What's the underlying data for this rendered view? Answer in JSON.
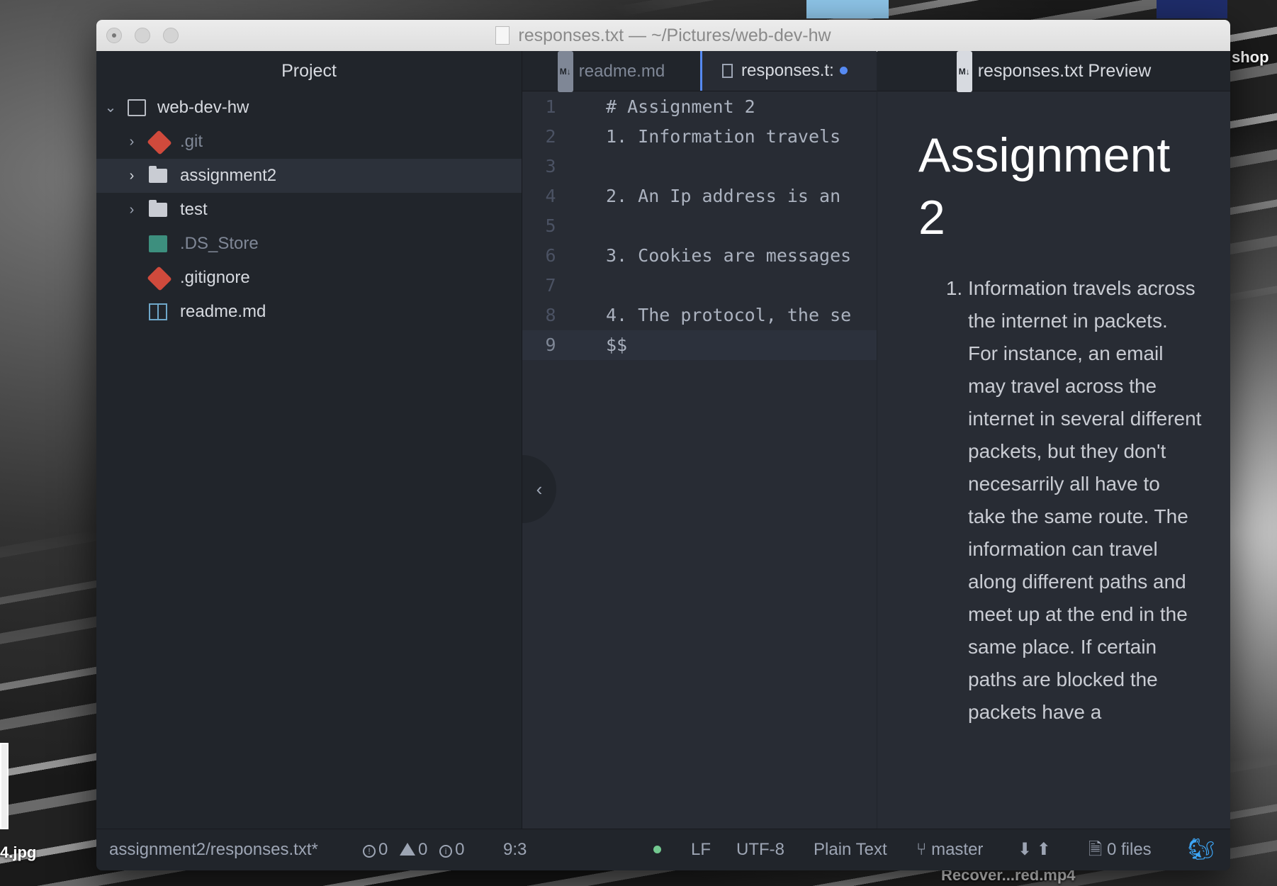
{
  "desktop": {
    "labels": [
      "shop",
      "4.jpg",
      "Recover...red.mp4"
    ]
  },
  "window": {
    "title": "responses.txt — ~/Pictures/web-dev-hw"
  },
  "sidebar": {
    "header": "Project",
    "root": "web-dev-hw",
    "items": [
      {
        "label": ".git",
        "icon": "git-icon"
      },
      {
        "label": "assignment2",
        "icon": "folder-icon"
      },
      {
        "label": "test",
        "icon": "folder-icon"
      },
      {
        "label": ".DS_Store",
        "icon": "finder-icon"
      },
      {
        "label": ".gitignore",
        "icon": "git-icon"
      },
      {
        "label": "readme.md",
        "icon": "book-icon"
      }
    ]
  },
  "tabs": [
    {
      "label": "readme.md",
      "badge": "M↓"
    },
    {
      "label": "responses.t:",
      "modified": true
    }
  ],
  "editor": {
    "lines": [
      {
        "num": "1",
        "text": "# Assignment 2"
      },
      {
        "num": "2",
        "text": "1. Information travels"
      },
      {
        "num": "3",
        "text": ""
      },
      {
        "num": "4",
        "text": "2. An Ip address is an"
      },
      {
        "num": "5",
        "text": ""
      },
      {
        "num": "6",
        "text": "3. Cookies are messages"
      },
      {
        "num": "7",
        "text": ""
      },
      {
        "num": "8",
        "text": "4. The protocol, the se"
      },
      {
        "num": "9",
        "text": "$$"
      }
    ]
  },
  "preview": {
    "header": "responses.txt Preview",
    "badge": "M↓",
    "title": "Assignment 2",
    "item1": "Information travels across the internet in packets. For instance, an email may travel across the internet in several different packets, but they don't necesarrily all have to take the same route. The information can travel along different paths and meet up at the end in the same place. If certain paths are blocked the packets have a"
  },
  "status": {
    "file": "assignment2/responses.txt*",
    "errors": "0",
    "warnings": "0",
    "infos": "0",
    "cursor": "9:3",
    "line_ending": "LF",
    "encoding": "UTF-8",
    "grammar": "Plain Text",
    "branch": "master",
    "files": "0 files"
  },
  "colors": {
    "accent": "#568af2",
    "git_red": "#d04a3c",
    "status_green": "#73c990"
  }
}
